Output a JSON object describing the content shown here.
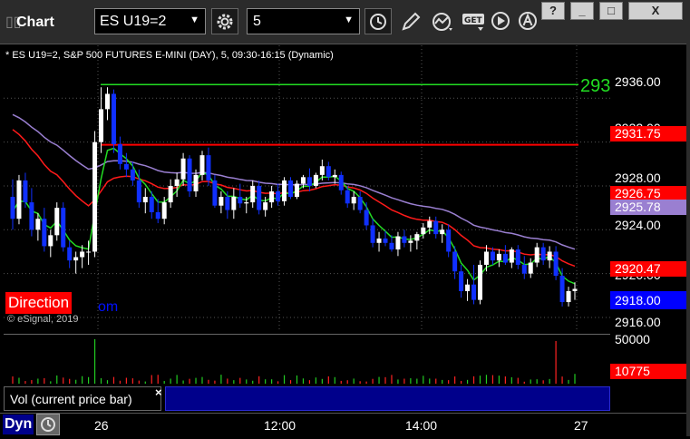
{
  "toolbar": {
    "title": "Chart",
    "symbol": "ES U19=2",
    "interval": "5",
    "window_buttons": [
      "?",
      "_",
      "□",
      "X"
    ]
  },
  "chart": {
    "header": "* ES U19=2, S&P 500 FUTURES E-MINI (DAY), 5, 09:30-16:15 (Dynamic)",
    "overlay_label": "293",
    "copyright": "© eSignal, 2019",
    "direction_label": "Direction",
    "direction_tail": "om",
    "price_axis": [
      "2936.00",
      "2932.00",
      "2928.00",
      "2924.00",
      "2920.00",
      "2916.00"
    ],
    "price_tags": [
      {
        "label": "2931.75",
        "bg": "#ff0000"
      },
      {
        "label": "2926.75",
        "bg": "#ff0000"
      },
      {
        "label": "2925.78",
        "bg": "#9a7fd1"
      },
      {
        "label": "2920.47",
        "bg": "#ff0000"
      },
      {
        "label": "2918.00",
        "bg": "#0000ff"
      }
    ]
  },
  "volume": {
    "legend": "Vol (current price bar)",
    "axis_label": "50000",
    "tag": "10775",
    "tag_bg": "#ff0000"
  },
  "time_axis": {
    "labels": [
      "26",
      "12:00",
      "14:00",
      "27"
    ],
    "dyn_label": "Dyn"
  },
  "chart_data": {
    "type": "candlestick",
    "ylim": [
      2915.5,
      2939.5
    ],
    "candles": [
      [
        2927.0,
        2928.6,
        2924.0,
        2925.0
      ],
      [
        2925.0,
        2929.0,
        2924.5,
        2928.5
      ],
      [
        2928.5,
        2929.2,
        2926.0,
        2926.5
      ],
      [
        2926.5,
        2927.8,
        2923.4,
        2924.0
      ],
      [
        2924.0,
        2925.5,
        2923.0,
        2925.0
      ],
      [
        2925.0,
        2926.0,
        2922.0,
        2922.5
      ],
      [
        2922.5,
        2924.0,
        2921.5,
        2923.5
      ],
      [
        2923.5,
        2926.5,
        2923.0,
        2926.0
      ],
      [
        2926.0,
        2926.5,
        2922.0,
        2922.4
      ],
      [
        2922.4,
        2923.0,
        2920.5,
        2921.2
      ],
      [
        2921.2,
        2922.0,
        2920.0,
        2921.5
      ],
      [
        2921.5,
        2922.6,
        2920.5,
        2922.0
      ],
      [
        2922.0,
        2923.0,
        2920.8,
        2922.0
      ],
      [
        2922.0,
        2933.0,
        2921.5,
        2932.0
      ],
      [
        2932.0,
        2937.0,
        2931.0,
        2935.0
      ],
      [
        2935.0,
        2937.0,
        2934.0,
        2936.4
      ],
      [
        2936.4,
        2936.8,
        2931.0,
        2931.8
      ],
      [
        2931.8,
        2932.5,
        2929.5,
        2930.0
      ],
      [
        2930.0,
        2931.0,
        2928.8,
        2929.5
      ],
      [
        2929.5,
        2930.2,
        2928.0,
        2928.5
      ],
      [
        2928.5,
        2929.5,
        2926.0,
        2926.5
      ],
      [
        2926.5,
        2927.8,
        2925.5,
        2927.0
      ],
      [
        2927.0,
        2927.5,
        2925.0,
        2925.6
      ],
      [
        2925.6,
        2926.8,
        2924.6,
        2925.0
      ],
      [
        2925.0,
        2927.0,
        2924.5,
        2926.5
      ],
      [
        2926.5,
        2928.6,
        2926.0,
        2928.0
      ],
      [
        2928.0,
        2929.2,
        2927.0,
        2928.6
      ],
      [
        2928.6,
        2931.0,
        2928.0,
        2930.5
      ],
      [
        2930.5,
        2930.8,
        2927.0,
        2927.5
      ],
      [
        2927.5,
        2929.5,
        2927.0,
        2929.0
      ],
      [
        2929.0,
        2931.2,
        2928.5,
        2930.8
      ],
      [
        2930.8,
        2931.5,
        2928.0,
        2928.5
      ],
      [
        2928.5,
        2929.0,
        2926.0,
        2926.2
      ],
      [
        2926.2,
        2927.5,
        2925.5,
        2927.0
      ],
      [
        2927.0,
        2927.5,
        2925.0,
        2925.8
      ],
      [
        2925.8,
        2927.8,
        2925.0,
        2927.0
      ],
      [
        2927.0,
        2928.2,
        2926.0,
        2926.4
      ],
      [
        2926.4,
        2927.0,
        2925.5,
        2926.5
      ],
      [
        2926.5,
        2928.5,
        2926.0,
        2928.0
      ],
      [
        2928.0,
        2928.5,
        2925.4,
        2925.8
      ],
      [
        2925.8,
        2927.0,
        2925.2,
        2926.5
      ],
      [
        2926.5,
        2928.0,
        2926.0,
        2927.5
      ],
      [
        2927.5,
        2928.2,
        2926.2,
        2926.6
      ],
      [
        2926.6,
        2928.8,
        2926.2,
        2928.5
      ],
      [
        2928.5,
        2928.8,
        2926.8,
        2927.0
      ],
      [
        2927.0,
        2928.5,
        2926.8,
        2928.2
      ],
      [
        2928.2,
        2929.0,
        2927.8,
        2928.8
      ],
      [
        2928.8,
        2929.6,
        2927.5,
        2928.0
      ],
      [
        2928.0,
        2929.2,
        2927.8,
        2929.0
      ],
      [
        2929.0,
        2930.4,
        2928.5,
        2929.8
      ],
      [
        2929.8,
        2930.2,
        2928.5,
        2928.8
      ],
      [
        2928.8,
        2929.5,
        2928.2,
        2929.0
      ],
      [
        2929.0,
        2929.3,
        2927.2,
        2927.6
      ],
      [
        2927.6,
        2928.0,
        2926.0,
        2926.4
      ],
      [
        2926.4,
        2927.5,
        2925.8,
        2927.0
      ],
      [
        2927.0,
        2927.5,
        2925.5,
        2925.8
      ],
      [
        2925.8,
        2926.5,
        2924.0,
        2924.4
      ],
      [
        2924.4,
        2925.0,
        2922.4,
        2922.8
      ],
      [
        2922.8,
        2923.8,
        2922.0,
        2923.2
      ],
      [
        2923.2,
        2923.9,
        2922.5,
        2922.8
      ],
      [
        2922.8,
        2923.5,
        2922.0,
        2922.2
      ],
      [
        2922.2,
        2923.8,
        2921.6,
        2923.4
      ],
      [
        2923.4,
        2924.0,
        2922.4,
        2922.8
      ],
      [
        2922.8,
        2923.5,
        2922.0,
        2923.0
      ],
      [
        2923.0,
        2923.8,
        2922.2,
        2923.6
      ],
      [
        2923.6,
        2924.6,
        2923.2,
        2924.2
      ],
      [
        2924.2,
        2925.2,
        2923.6,
        2924.8
      ],
      [
        2924.8,
        2925.2,
        2923.2,
        2923.6
      ],
      [
        2923.6,
        2924.5,
        2922.8,
        2924.0
      ],
      [
        2924.0,
        2924.5,
        2921.5,
        2922.0
      ],
      [
        2922.0,
        2922.5,
        2919.5,
        2920.2
      ],
      [
        2920.2,
        2920.8,
        2917.8,
        2918.4
      ],
      [
        2918.4,
        2919.5,
        2917.5,
        2919.0
      ],
      [
        2919.0,
        2920.8,
        2917.2,
        2917.6
      ],
      [
        2917.6,
        2921.2,
        2917.2,
        2920.8
      ],
      [
        2920.8,
        2922.6,
        2920.2,
        2922.0
      ],
      [
        2922.0,
        2922.4,
        2920.8,
        2921.2
      ],
      [
        2921.2,
        2922.2,
        2920.6,
        2921.8
      ],
      [
        2921.8,
        2922.6,
        2920.8,
        2921.0
      ],
      [
        2921.0,
        2922.4,
        2920.5,
        2922.2
      ],
      [
        2922.2,
        2922.6,
        2920.4,
        2920.8
      ],
      [
        2920.8,
        2921.6,
        2919.5,
        2920.0
      ],
      [
        2920.0,
        2921.4,
        2919.6,
        2921.0
      ],
      [
        2921.0,
        2922.8,
        2920.6,
        2922.4
      ],
      [
        2922.4,
        2922.8,
        2920.8,
        2921.2
      ],
      [
        2921.2,
        2922.5,
        2920.5,
        2922.0
      ],
      [
        2922.0,
        2922.5,
        2919.4,
        2919.8
      ],
      [
        2919.8,
        2920.5,
        2917.0,
        2917.4
      ],
      [
        2917.4,
        2918.8,
        2917.0,
        2918.4
      ],
      [
        2918.4,
        2919.2,
        2917.6,
        2918.6
      ]
    ],
    "volume_max": 50000,
    "volume_last": 10775,
    "reference_lines": [
      2937.25,
      2931.75
    ]
  }
}
